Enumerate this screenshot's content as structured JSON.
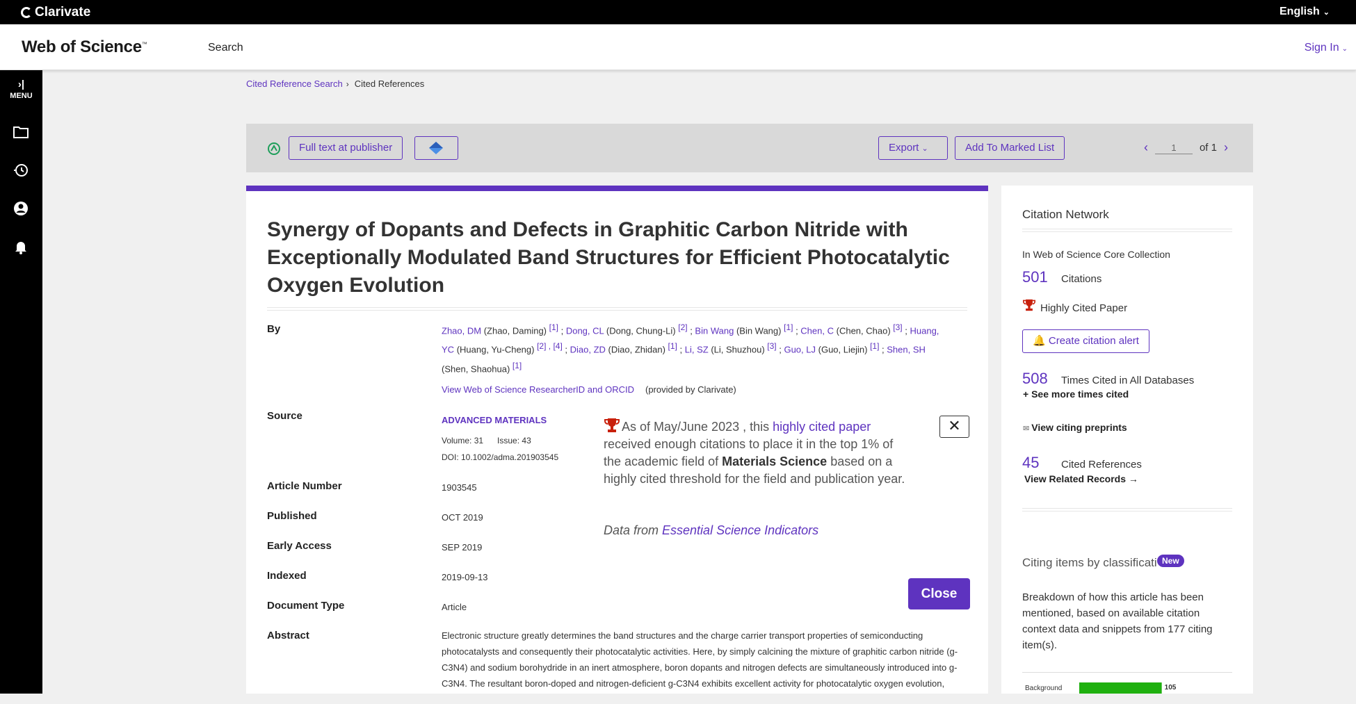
{
  "topbar": {
    "brand": "Clarivate",
    "language": "English"
  },
  "header": {
    "logo": "Web of Science",
    "logo_mark": "™",
    "nav_search": "Search",
    "sign_in": "Sign In"
  },
  "sidebar": {
    "menu_label": "MENU",
    "icons": [
      "folder-icon",
      "history-icon",
      "user-icon",
      "bell-icon"
    ]
  },
  "breadcrumb": {
    "items": [
      "Cited Reference Search",
      "Cited References"
    ]
  },
  "toolbar": {
    "full_text": "Full text at publisher",
    "export": "Export",
    "add_marked": "Add To Marked List",
    "page_value": "1",
    "of_label": "of 1"
  },
  "record": {
    "title": "Synergy of Dopants and Defects in Graphitic Carbon Nitride with Exceptionally Modulated Band Structures for Efficient Photocatalytic Oxygen Evolution",
    "labels": {
      "by": "By",
      "source": "Source",
      "article_number": "Article Number",
      "published": "Published",
      "early_access": "Early Access",
      "indexed": "Indexed",
      "document_type": "Document Type",
      "abstract": "Abstract"
    },
    "authors": [
      {
        "short": "Zhao, DM",
        "full": "(Zhao, Daming)",
        "refs": "[1]"
      },
      {
        "short": "Dong, CL",
        "full": "(Dong, Chung-Li)",
        "refs": "[2]"
      },
      {
        "short": "Bin Wang",
        "full": "(Bin Wang)",
        "refs": "[1]"
      },
      {
        "short": "Chen, C",
        "full": "(Chen, Chao)",
        "refs": "[3]"
      },
      {
        "short": "Huang, YC",
        "full": "(Huang, Yu-Cheng)",
        "refs": "[2] , [4]"
      },
      {
        "short": "Diao, ZD",
        "full": "(Diao, Zhidan)",
        "refs": "[1]"
      },
      {
        "short": "Li, SZ",
        "full": "(Li, Shuzhou)",
        "refs": "[3]"
      },
      {
        "short": "Guo, LJ",
        "full": "(Guo, Liejin)",
        "refs": "[1]"
      },
      {
        "short": "Shen, SH",
        "full": "(Shen, Shaohua)",
        "refs": "[1]"
      }
    ],
    "researcher_link": "View Web of Science ResearcherID and ORCID",
    "provided_by": "(provided by Clarivate)",
    "source_name": "ADVANCED MATERIALS",
    "volume": "Volume: 31",
    "issue": "Issue: 43",
    "doi": "DOI: 10.1002/adma.201903545",
    "article_number": "1903545",
    "published": "OCT 2019",
    "early_access": "SEP 2019",
    "indexed": "2019-09-13",
    "document_type": "Article",
    "abstract": "Electronic structure greatly determines the band structures and the charge carrier transport properties of semiconducting photocatalysts and consequently their photocatalytic activities. Here, by simply calcining the mixture of graphitic carbon nitride (g-C3N4) and sodium borohydride in an inert atmosphere, boron dopants and nitrogen defects are simultaneously introduced into g-C3N4. The resultant boron-doped and nitrogen-deficient g-C3N4 exhibits excellent activity for photocatalytic oxygen evolution,"
  },
  "popup": {
    "part1": "As of May/June 2023 , this ",
    "link": "highly cited paper",
    "part2": " received enough citations to place it in the top 1% of the academic field of ",
    "field": "Materials Science",
    "part3": " based on a highly cited threshold for the field and publication year.",
    "data_from": "Data from ",
    "esi": "Essential Science Indicators",
    "close_x": "✕",
    "close": "Close"
  },
  "citation_network": {
    "heading": "Citation Network",
    "collection": "In Web of Science Core Collection",
    "citations_num": "501",
    "citations_label": "Citations",
    "highly_cited": "Highly Cited Paper",
    "create_alert": "Create citation alert",
    "all_db_num": "508",
    "all_db_label": "Times Cited in All Databases",
    "see_more": "See more times cited",
    "preprints": "View citing preprints",
    "refs_num": "45",
    "refs_label": "Cited References",
    "related": "View Related Records",
    "classification_title": "Citing items by classificati",
    "new_badge": "New",
    "breakdown": "Breakdown of how this article has been mentioned, based on available citation context data and snippets from 177 citing item(s).",
    "chart_data": {
      "type": "bar",
      "categories": [
        "Background"
      ],
      "values": [
        105
      ]
    }
  },
  "colors": {
    "accent": "#5e33bf",
    "bar": "#1fb00f",
    "trophy": "#c8200c"
  }
}
